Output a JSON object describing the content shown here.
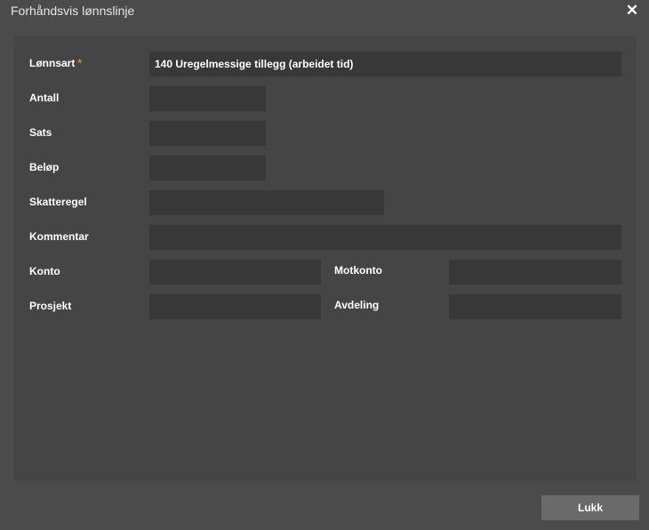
{
  "dialog": {
    "title": "Forhåndsvis lønnslinje",
    "close_icon": "close-icon",
    "close_glyph": "✕"
  },
  "form": {
    "lonnsart": {
      "label": "Lønnsart",
      "required_mark": "*",
      "value": "140 Uregelmessige tillegg (arbeidet tid)"
    },
    "antall": {
      "label": "Antall",
      "value": ""
    },
    "sats": {
      "label": "Sats",
      "value": ""
    },
    "belop": {
      "label": "Beløp",
      "value": ""
    },
    "skatteregel": {
      "label": "Skatteregel",
      "value": ""
    },
    "kommentar": {
      "label": "Kommentar",
      "value": ""
    },
    "konto": {
      "label": "Konto",
      "value": ""
    },
    "motkonto": {
      "label": "Motkonto",
      "value": ""
    },
    "prosjekt": {
      "label": "Prosjekt",
      "value": ""
    },
    "avdeling": {
      "label": "Avdeling",
      "value": ""
    }
  },
  "footer": {
    "close_label": "Lukk"
  },
  "colors": {
    "background": "#4b4b4b",
    "panel": "#454545",
    "field": "#383838",
    "button": "#6a6a6a",
    "required": "#e08a2e"
  }
}
